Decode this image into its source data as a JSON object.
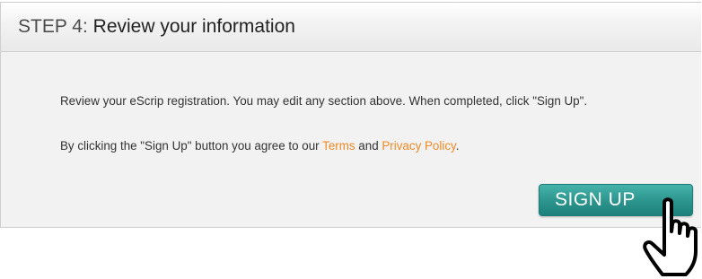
{
  "header": {
    "step_label": "STEP 4:",
    "title": "Review your information"
  },
  "body": {
    "review_text": "Review your eScrip registration. You may edit any section above. When completed, click \"Sign Up\".",
    "agree_prefix": "By clicking the \"Sign Up\" button you agree to our ",
    "terms_link": "Terms",
    "and_text": " and ",
    "privacy_link": "Privacy Policy",
    "agree_suffix": "."
  },
  "signup_button": {
    "label": "SIGN UP"
  },
  "colors": {
    "button": "#2b948d",
    "link": "#f08a24"
  },
  "icons": {
    "cursor": "hand-pointer-icon"
  }
}
